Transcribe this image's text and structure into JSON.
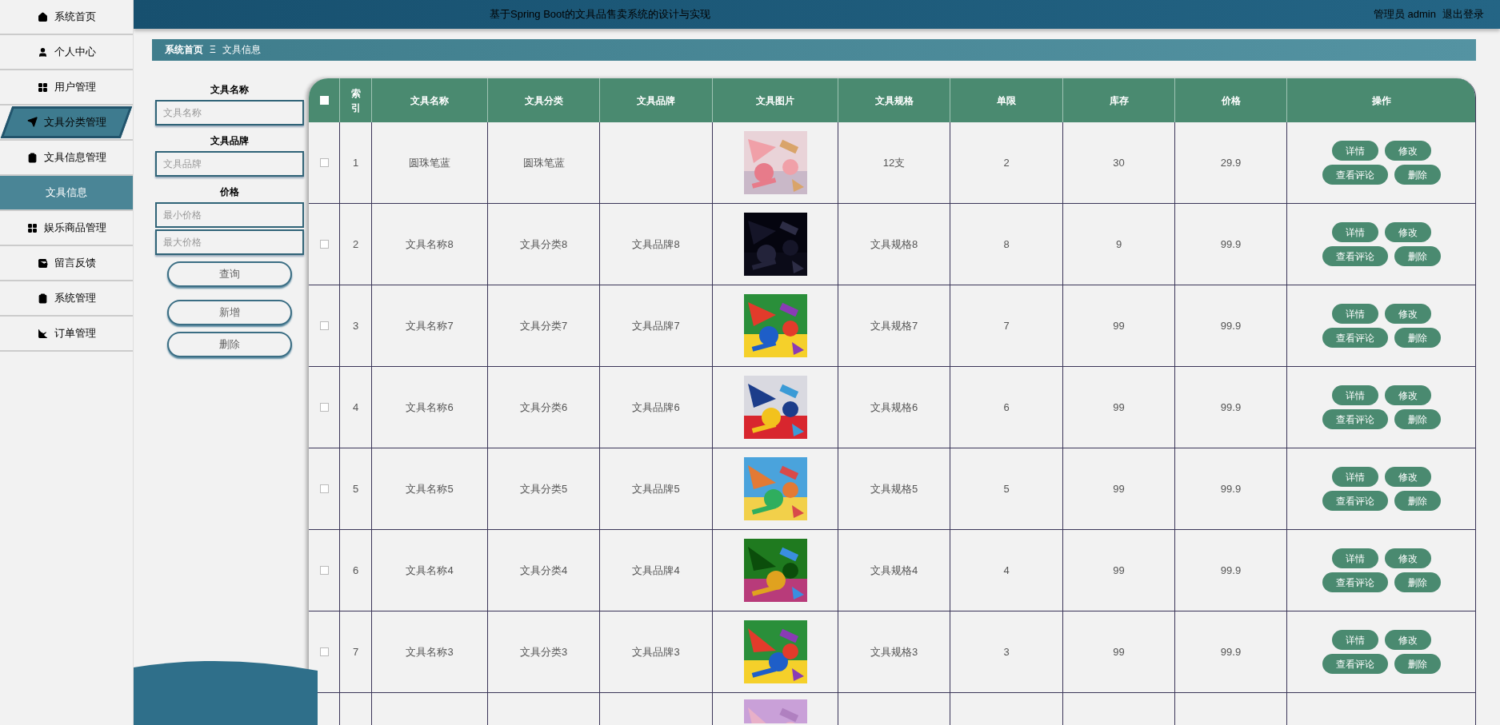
{
  "header": {
    "title": "基于Spring Boot的文具品售卖系统的设计与实现",
    "user": "管理员 admin",
    "logout": "退出登录"
  },
  "sidebar": {
    "items": [
      {
        "label": "系统首页",
        "selected": false,
        "hover": false
      },
      {
        "label": "个人中心",
        "selected": false,
        "hover": false
      },
      {
        "label": "用户管理",
        "selected": false,
        "hover": false
      },
      {
        "label": "文具分类管理",
        "selected": false,
        "hover": true
      },
      {
        "label": "文具信息管理",
        "selected": false,
        "hover": false,
        "children": [
          {
            "label": "文具信息",
            "selected": true
          }
        ]
      },
      {
        "label": "娱乐商品管理",
        "selected": false,
        "hover": false
      },
      {
        "label": "留言反馈",
        "selected": false,
        "hover": false
      },
      {
        "label": "系统管理",
        "selected": false,
        "hover": false
      },
      {
        "label": "订单管理",
        "selected": false,
        "hover": false
      }
    ]
  },
  "breadcrumb": {
    "home": "系统首页",
    "separator": "Ξ",
    "current": "文具信息"
  },
  "filters": {
    "name_label": "文具名称",
    "name_placeholder": "文具名称",
    "brand_label": "文具品牌",
    "brand_placeholder": "文具品牌",
    "price_label": "价格",
    "min_placeholder": "最小价格",
    "max_placeholder": "最大价格",
    "buttons": [
      "查询",
      "新增",
      "删除"
    ]
  },
  "table": {
    "select_all": {
      "checked": false
    },
    "columns": [
      "索引",
      "文具名称",
      "文具分类",
      "文具品牌",
      "文具图片",
      "文具规格",
      "单限",
      "库存",
      "价格",
      "操作"
    ],
    "rows": [
      {
        "checked": false,
        "index": "1",
        "name": "圆珠笔蓝",
        "category": "圆珠笔蓝",
        "spec": "12支",
        "limit": "2",
        "stock": "30",
        "price": "29.9",
        "actions": [
          "详情",
          "修改",
          "查看评论",
          "删除"
        ]
      },
      {
        "checked": false,
        "index": "2",
        "name": "文具名称8",
        "category": "文具分类8",
        "brand": "文具品牌8",
        "spec": "文具规格8",
        "limit": "8",
        "stock": "9",
        "price": "99.9",
        "actions": [
          "详情",
          "修改",
          "查看评论",
          "删除"
        ]
      },
      {
        "checked": false,
        "index": "3",
        "name": "文具名称7",
        "category": "文具分类7",
        "brand": "文具品牌7",
        "spec": "文具规格7",
        "limit": "7",
        "stock": "99",
        "price": "99.9",
        "actions": [
          "详情",
          "修改",
          "查看评论",
          "删除"
        ]
      },
      {
        "checked": false,
        "index": "4",
        "name": "文具名称6",
        "category": "文具分类6",
        "brand": "文具品牌6",
        "spec": "文具规格6",
        "limit": "6",
        "stock": "99",
        "price": "99.9",
        "actions": [
          "详情",
          "修改",
          "查看评论",
          "删除"
        ]
      },
      {
        "checked": false,
        "index": "5",
        "name": "文具名称5",
        "category": "文具分类5",
        "brand": "文具品牌5",
        "spec": "文具规格5",
        "limit": "5",
        "stock": "99",
        "price": "99.9",
        "actions": [
          "详情",
          "修改",
          "查看评论",
          "删除"
        ]
      },
      {
        "checked": false,
        "index": "6",
        "name": "文具名称4",
        "category": "文具分类4",
        "brand": "文具品牌4",
        "spec": "文具规格4",
        "limit": "4",
        "stock": "99",
        "price": "99.9",
        "actions": [
          "详情",
          "修改",
          "查看评论",
          "删除"
        ]
      },
      {
        "checked": false,
        "index": "7",
        "name": "文具名称3",
        "category": "文具分类3",
        "brand": "文具品牌3",
        "spec": "文具规格3",
        "limit": "3",
        "stock": "99",
        "price": "99.9",
        "actions": [
          "详情",
          "修改",
          "查看评论",
          "删除"
        ]
      }
    ]
  }
}
